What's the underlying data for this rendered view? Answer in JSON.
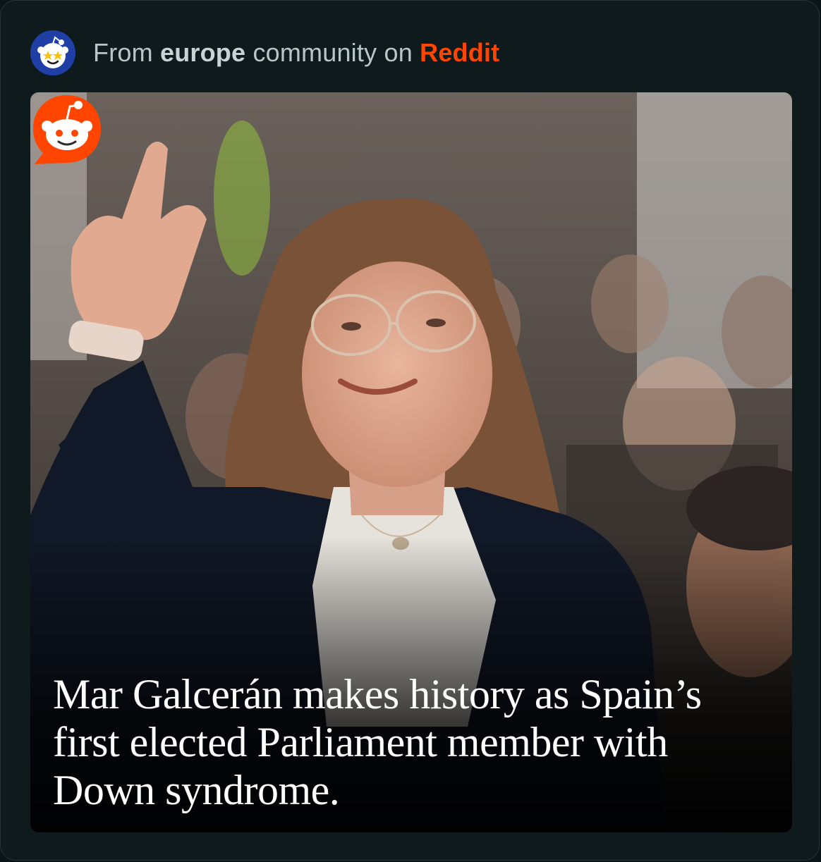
{
  "header": {
    "prefix": "From",
    "community": "europe",
    "middle": "community on",
    "brand": "Reddit",
    "avatar_icon": "reddit-starry-eyed-snoo-icon"
  },
  "post": {
    "image_description": "Woman with glasses and long brown hair waving in front of a seated crowd",
    "headline": "Mar Galcerán makes history as Spain’s first elected Parliament member with Down syndrome."
  },
  "badge": {
    "icon": "reddit-snoo-speech-bubble-icon"
  },
  "colors": {
    "background": "#0e1a1c",
    "brand": "#ff4500",
    "text_muted": "#b8c5c9",
    "avatar_bg": "#1f3fa6"
  }
}
